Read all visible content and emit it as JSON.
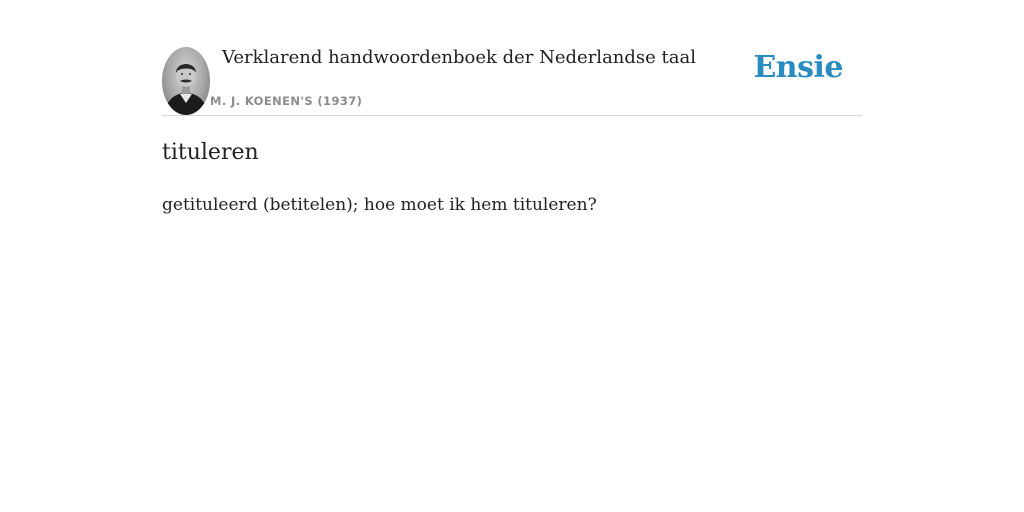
{
  "header": {
    "book_title": "Verklarend handwoordenboek der Nederlandse taal",
    "author": "M. J. KOENEN'S (1937)",
    "portrait_icon": "author-portrait",
    "brand": "Ensie",
    "brand_color": "#2a8bc0"
  },
  "entry": {
    "headword": "tituleren",
    "definition": "getituleerd (betitelen); hoe moet ik hem tituleren?"
  }
}
